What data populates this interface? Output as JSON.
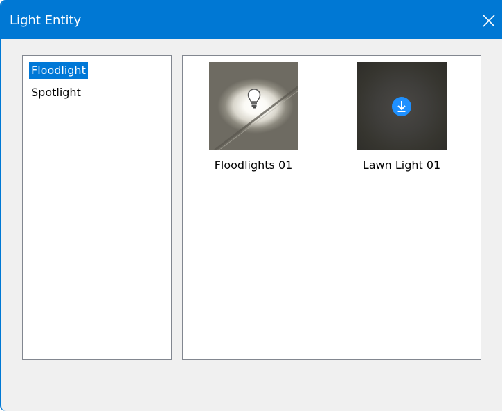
{
  "window": {
    "title": "Light Entity",
    "accent_color": "#0078d4"
  },
  "categories": {
    "items": [
      {
        "label": "Floodlight",
        "selected": true
      },
      {
        "label": "Spotlight",
        "selected": false
      }
    ]
  },
  "gallery": {
    "items": [
      {
        "label": "Floodlights 01",
        "icon": "lightbulb-icon"
      },
      {
        "label": "Lawn Light 01",
        "icon": "download-icon"
      }
    ]
  }
}
